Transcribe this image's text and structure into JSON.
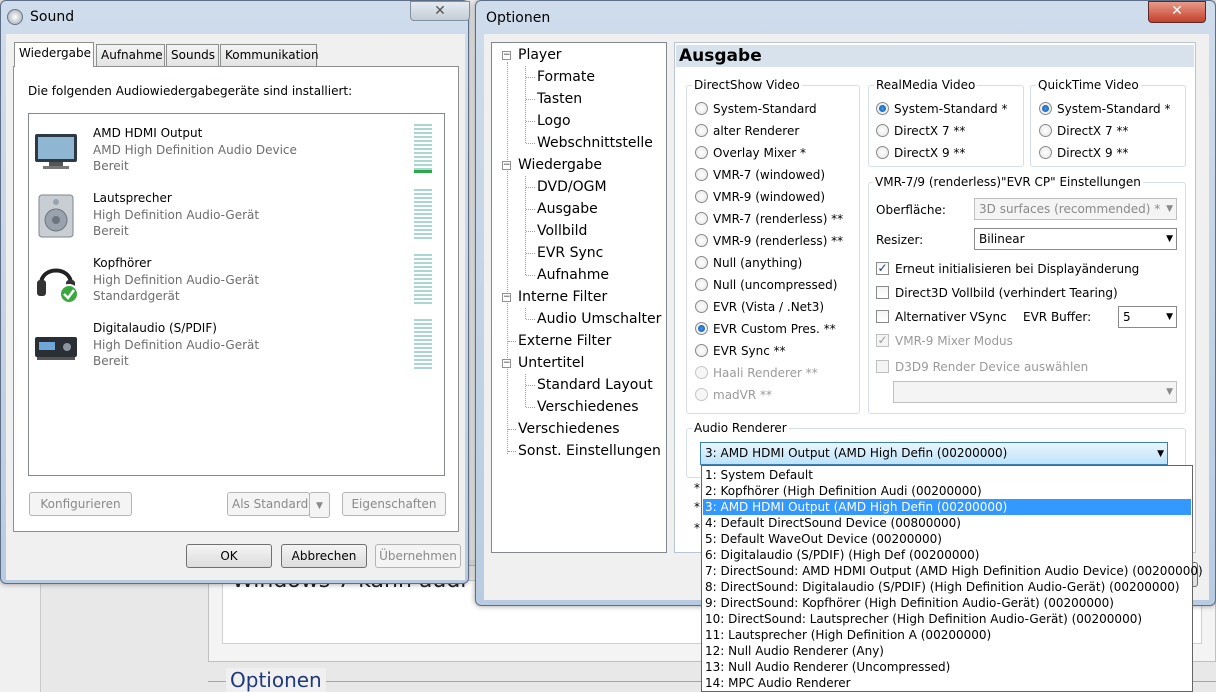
{
  "background": {
    "heading_partial": "Windows 7 kann audi",
    "section_label": "Optionen"
  },
  "sound": {
    "title": "Sound",
    "tabs": [
      "Wiedergabe",
      "Aufnahme",
      "Sounds",
      "Kommunikation"
    ],
    "intro": "Die folgenden Audiowiedergabegeräte sind installiert:",
    "devices": [
      {
        "name": "AMD HDMI Output",
        "desc": "AMD High Definition Audio Device",
        "status": "Bereit",
        "icon": "monitor-icon"
      },
      {
        "name": "Lautsprecher",
        "desc": "High Definition Audio-Gerät",
        "status": "Bereit",
        "icon": "speaker-icon"
      },
      {
        "name": "Kopfhörer",
        "desc": "High Definition Audio-Gerät",
        "status": "Standardgerät",
        "icon": "headphones-icon"
      },
      {
        "name": "Digitalaudio (S/PDIF)",
        "desc": "High Definition Audio-Gerät",
        "status": "Bereit",
        "icon": "digital-audio-icon"
      }
    ],
    "buttons": {
      "configure": "Konfigurieren",
      "set_default": "Als Standard",
      "properties": "Eigenschaften",
      "ok": "OK",
      "cancel": "Abbrechen",
      "apply": "Übernehmen"
    }
  },
  "options": {
    "title": "Optionen",
    "tree": [
      {
        "label": "Player",
        "level": 0,
        "expander": "−"
      },
      {
        "label": "Formate",
        "level": 1
      },
      {
        "label": "Tasten",
        "level": 1
      },
      {
        "label": "Logo",
        "level": 1
      },
      {
        "label": "Webschnittstelle",
        "level": 1
      },
      {
        "label": "Wiedergabe",
        "level": 0,
        "expander": "−"
      },
      {
        "label": "DVD/OGM",
        "level": 1
      },
      {
        "label": "Ausgabe",
        "level": 1
      },
      {
        "label": "Vollbild",
        "level": 1
      },
      {
        "label": "EVR Sync",
        "level": 1
      },
      {
        "label": "Aufnahme",
        "level": 1
      },
      {
        "label": "Interne Filter",
        "level": 0,
        "expander": "−"
      },
      {
        "label": "Audio Umschalter",
        "level": 1
      },
      {
        "label": "Externe Filter",
        "level": 0
      },
      {
        "label": "Untertitel",
        "level": 0,
        "expander": "−"
      },
      {
        "label": "Standard Layout",
        "level": 1
      },
      {
        "label": "Verschiedenes",
        "level": 1
      },
      {
        "label": "Verschiedenes",
        "level": 0
      },
      {
        "label": "Sonst. Einstellungen",
        "level": 0
      }
    ],
    "panel_title": "Ausgabe",
    "directshow": {
      "label": "DirectShow Video",
      "items": [
        "System-Standard",
        "alter Renderer",
        "Overlay Mixer *",
        "VMR-7 (windowed)",
        "VMR-9 (windowed)",
        "VMR-7 (renderless) **",
        "VMR-9 (renderless) **",
        "Null (anything)",
        "Null (uncompressed)",
        "EVR (Vista / .Net3)",
        "EVR Custom Pres. **",
        "EVR Sync **",
        "Haali Renderer **",
        "madVR **"
      ],
      "selected": 10,
      "disabled": [
        12,
        13
      ]
    },
    "realmedia": {
      "label": "RealMedia Video",
      "items": [
        "System-Standard *",
        "DirectX 7 **",
        "DirectX 9 **"
      ],
      "selected": 0
    },
    "quicktime": {
      "label": "QuickTime Video",
      "items": [
        "System-Standard *",
        "DirectX 7 **",
        "DirectX 9 **"
      ],
      "selected": 0
    },
    "vmr": {
      "label": "VMR-7/9 (renderless)\"EVR CP\" Einstellungen",
      "surface_label": "Oberfläche:",
      "surface_value": "3D surfaces (recommended) *",
      "resizer_label": "Resizer:",
      "resizer_value": "Bilinear",
      "reinit": "Erneut initialisieren bei Displayänderung",
      "d3d_fullscreen": "Direct3D Vollbild (verhindert Tearing)",
      "alt_vsync": "Alternativer VSync",
      "evr_buffer_label": "EVR Buffer:",
      "evr_buffer_value": "5",
      "vmr9_mixer": "VMR-9 Mixer Modus",
      "d3d9_device": "D3D9 Render Device auswählen",
      "d3d9_device_value": ""
    },
    "audio": {
      "label": "Audio Renderer",
      "value": "3: AMD HDMI Output (AMD High Defin (00200000)",
      "options": [
        "1: System Default",
        "2: Kopfhörer (High Definition Audi (00200000)",
        "3: AMD HDMI Output (AMD High Defin (00200000)",
        "4: Default DirectSound Device (00800000)",
        "5: Default WaveOut Device (00200000)",
        "6: Digitalaudio (S/PDIF) (High Def (00200000)",
        "7: DirectSound: AMD HDMI Output (AMD High Definition Audio Device) (00200000)",
        "8: DirectSound: Digitalaudio (S/PDIF) (High Definition Audio-Gerät) (00200000)",
        "9: DirectSound: Kopfhörer (High Definition Audio-Gerät) (00200000)",
        "10: DirectSound: Lautsprecher (High Definition Audio-Gerät) (00200000)",
        "11: Lautsprecher (High Definition A (00200000)",
        "12: Null Audio Renderer (Any)",
        "13: Null Audio Renderer (Uncompressed)",
        "14: MPC Audio Renderer"
      ],
      "selected_index": 2
    }
  }
}
